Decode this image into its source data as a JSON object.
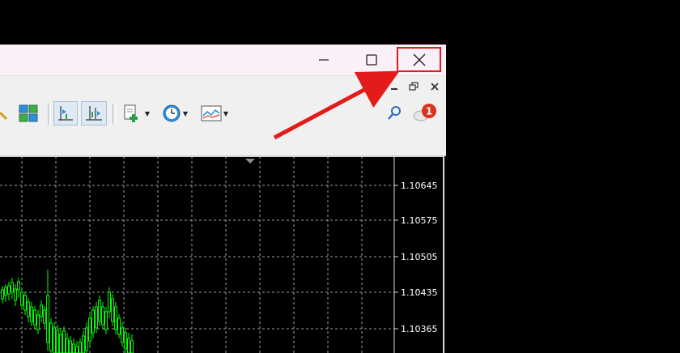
{
  "window": {
    "controls": {
      "minimize": "minimize",
      "maximize": "maximize",
      "close": "close"
    }
  },
  "mdi_controls": [
    "minimize",
    "restore",
    "close"
  ],
  "toolbar": {
    "icons": [
      "zoom-out-icon",
      "tile-windows-icon",
      "chart-shift-icon",
      "autoscroll-icon",
      "indicators-icon",
      "periods-icon",
      "templates-icon",
      "search-icon",
      "notifications-icon"
    ],
    "notification_count": "1"
  },
  "price_axis": {
    "labels": [
      "1.10645",
      "1.10575",
      "1.10505",
      "1.10435",
      "1.10365"
    ]
  },
  "colors": {
    "close_highlight": "#e31b1b",
    "arrow": "#e31b1b",
    "candles": "#00ff00",
    "grid": "#a0a0a0",
    "notification_badge": "#d9321d"
  }
}
